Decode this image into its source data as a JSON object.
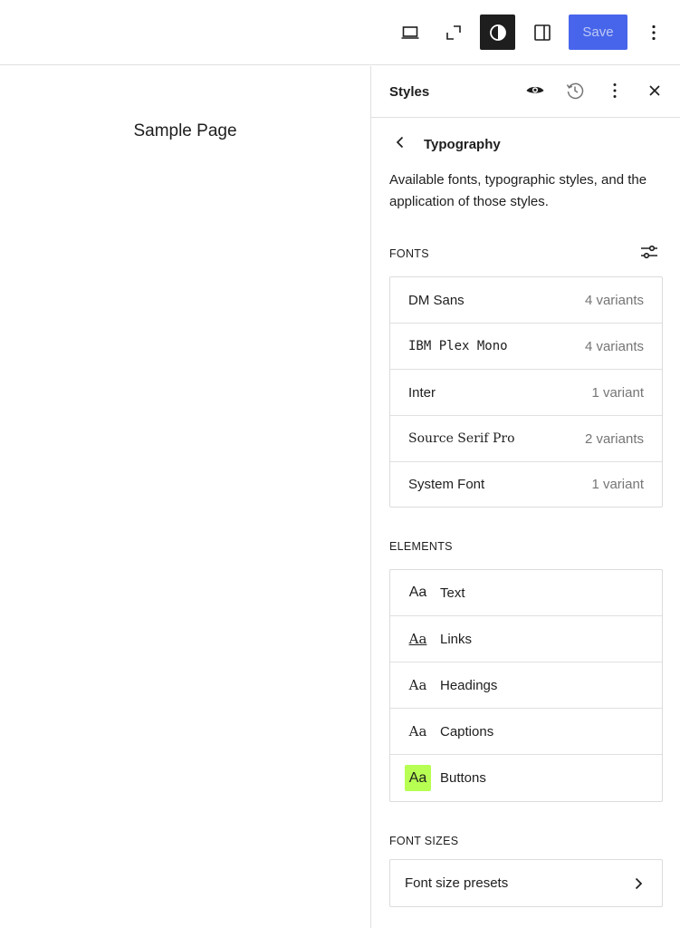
{
  "toolbar": {
    "save_label": "Save",
    "icons": [
      "desktop-icon",
      "fullscreen-icon",
      "styles-icon",
      "settings-icon",
      "more-vertical-icon"
    ]
  },
  "canvas": {
    "page_title": "Sample Page"
  },
  "sidebar": {
    "title": "Styles",
    "header_icons": [
      "eye-icon",
      "history-icon",
      "more-vertical-icon",
      "close-icon"
    ],
    "nav_title": "Typography",
    "description": "Available fonts, typographic styles, and the application of those styles.",
    "fonts_label": "FONTS",
    "fonts": [
      {
        "name": "DM Sans",
        "variants": "4 variants"
      },
      {
        "name": "IBM Plex Mono",
        "variants": "4 variants"
      },
      {
        "name": "Inter",
        "variants": "1 variant"
      },
      {
        "name": "Source Serif Pro",
        "variants": "2 variants"
      },
      {
        "name": "System Font",
        "variants": "1 variant"
      }
    ],
    "elements_label": "ELEMENTS",
    "elements": [
      {
        "preview": "Aa",
        "label": "Text"
      },
      {
        "preview": "Aa",
        "label": "Links"
      },
      {
        "preview": "Aa",
        "label": "Headings"
      },
      {
        "preview": "Aa",
        "label": "Captions"
      },
      {
        "preview": "Aa",
        "label": "Buttons"
      }
    ],
    "font_sizes_label": "FONT SIZES",
    "font_size_presets_label": "Font size presets"
  },
  "colors": {
    "accent": "#3858e9",
    "button_preview_bg": "#b7ff53",
    "dark": "#1e1e1e",
    "muted": "#757575",
    "border": "#e0e0e0"
  }
}
